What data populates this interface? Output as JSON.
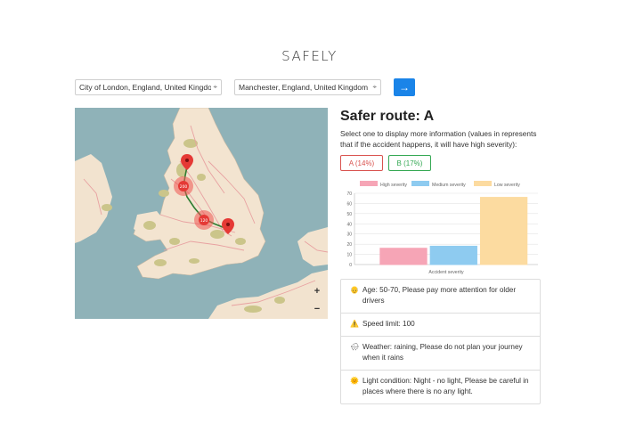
{
  "app": {
    "brand": "SAFELY"
  },
  "search": {
    "from_value": "City of London, England, United Kingdom",
    "to_value": "Manchester, England, United Kingdom",
    "locate_icon": "crosshair-icon",
    "go_icon": "arrow-right-icon"
  },
  "map": {
    "route_color": "#2e7d32",
    "marker_color": "#e53935",
    "zoom_in": "+",
    "zoom_out": "−"
  },
  "result": {
    "title": "Safer route: A",
    "hint": "Select one to display more information (values in represents that if the accident happens, it will have high severity):",
    "routes": [
      {
        "label": "A (14%)",
        "color": "#d9534f"
      },
      {
        "label": "B (17%)",
        "color": "#34a853"
      }
    ]
  },
  "chart_data": {
    "type": "bar",
    "xlabel": "Accident severity",
    "ylim": [
      0,
      70
    ],
    "yticks": [
      0,
      10,
      20,
      30,
      40,
      50,
      60,
      70
    ],
    "series": [
      {
        "name": "High severity",
        "value": 16,
        "color": "#f6a5b6"
      },
      {
        "name": "Medium severity",
        "value": 18,
        "color": "#8ecbf0"
      },
      {
        "name": "Low severity",
        "value": 66,
        "color": "#fcdba0"
      }
    ],
    "legend": "top",
    "grid": true
  },
  "info": [
    {
      "icon": "elderly-icon",
      "glyph": "👴",
      "text": "Age: 50-70, Please pay more attention for older drivers"
    },
    {
      "icon": "warning-icon",
      "glyph": "⚠️",
      "text": "Speed limit: 100"
    },
    {
      "icon": "rain-cloud-icon",
      "glyph": "🌧",
      "text": "Weather: raining, Please do not plan your journey when it rains"
    },
    {
      "icon": "sun-icon",
      "glyph": "🌞",
      "text": "Light condition: Night - no light, Please be careful in places where there is no any light."
    }
  ]
}
